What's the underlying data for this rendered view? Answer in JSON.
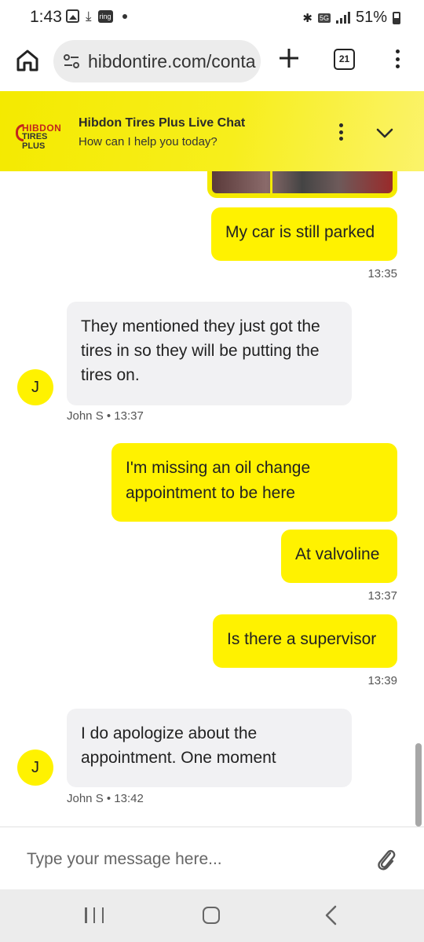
{
  "status_bar": {
    "time": "1:43",
    "ring_label": "ring",
    "network": "5G",
    "battery": "51%"
  },
  "browser": {
    "url": "hibdontire.com/conta",
    "tab_count": "21"
  },
  "chat": {
    "logo_top": "HIBDON",
    "logo_bottom": "TIRES PLUS",
    "title": "Hibdon Tires Plus Live Chat",
    "subtitle": "How can I help you today?",
    "brand_color": "#f4ea00",
    "messages": [
      {
        "from": "user",
        "text": "My car is still parked",
        "time": "13:35"
      },
      {
        "from": "agent",
        "avatar": "J",
        "text": "They mentioned they just got the tires in so they will be putting the tires on.",
        "meta": "John S • 13:37"
      },
      {
        "from": "user",
        "text": "I'm missing an oil change appointment to be here"
      },
      {
        "from": "user",
        "text": "At valvoline",
        "time": "13:37"
      },
      {
        "from": "user",
        "text": "Is there a supervisor",
        "time": "13:39"
      },
      {
        "from": "agent",
        "avatar": "J",
        "text": "I do apologize about the appointment. One moment",
        "meta": "John S • 13:42"
      }
    ]
  },
  "composer": {
    "placeholder": "Type your message here..."
  },
  "icons": {
    "home": "home-icon",
    "site_settings": "tune-icon",
    "new_tab": "plus-icon",
    "tabs": "tab-counter-icon",
    "more": "more-vert-icon",
    "collapse": "chevron-down-icon",
    "attach": "paperclip-icon",
    "nav_recent": "recent-apps-icon",
    "nav_home": "home-button-icon",
    "nav_back": "back-icon"
  }
}
